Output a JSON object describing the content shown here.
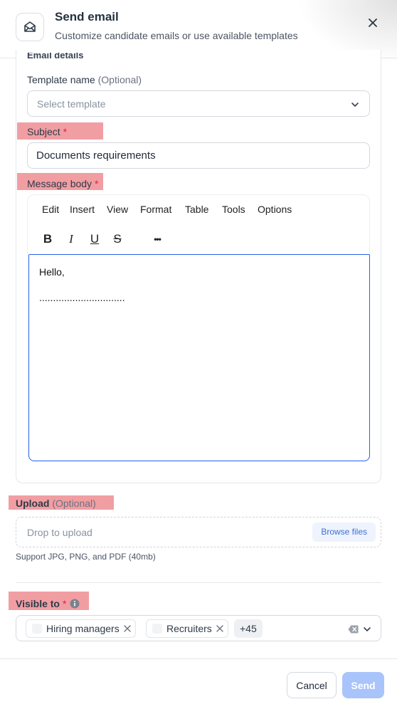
{
  "header": {
    "title": "Send email",
    "subtitle": "Customize candidate emails or use available templates",
    "icon": "mail-open-icon",
    "close_icon": "close-icon"
  },
  "email_details": {
    "section_label": "Email details",
    "template": {
      "label": "Template name",
      "optional": "(Optional)",
      "placeholder": "Select template"
    },
    "subject": {
      "label": "Subject",
      "required": "*",
      "value": "Documents requirements"
    },
    "message": {
      "label": "Message body",
      "required": "*",
      "menu": [
        "Edit",
        "Insert",
        "View",
        "Format",
        "Table",
        "Tools",
        "Options"
      ],
      "toolbar": {
        "bold": "B",
        "italic": "I",
        "underline": "U",
        "strike": "S",
        "more": "•••"
      },
      "body_line1": "Hello,",
      "body_line2": "..............................."
    }
  },
  "upload": {
    "label": "Upload",
    "optional": "(Optional)",
    "placeholder": "Drop to upload",
    "browse_label": "Browse files",
    "hint": "Support JPG, PNG, and PDF (40mb)"
  },
  "visible_to": {
    "label": "Visible to",
    "required": "*",
    "info_icon": "info-icon",
    "chips": [
      "Hiring managers",
      "Recruiters"
    ],
    "more_count": "+45"
  },
  "footer": {
    "cancel_label": "Cancel",
    "send_label": "Send"
  },
  "colors": {
    "highlight": "#e8626a",
    "primary_disabled": "#a9c4fb",
    "editor_focus": "#2563eb",
    "required": "#e11d48"
  }
}
